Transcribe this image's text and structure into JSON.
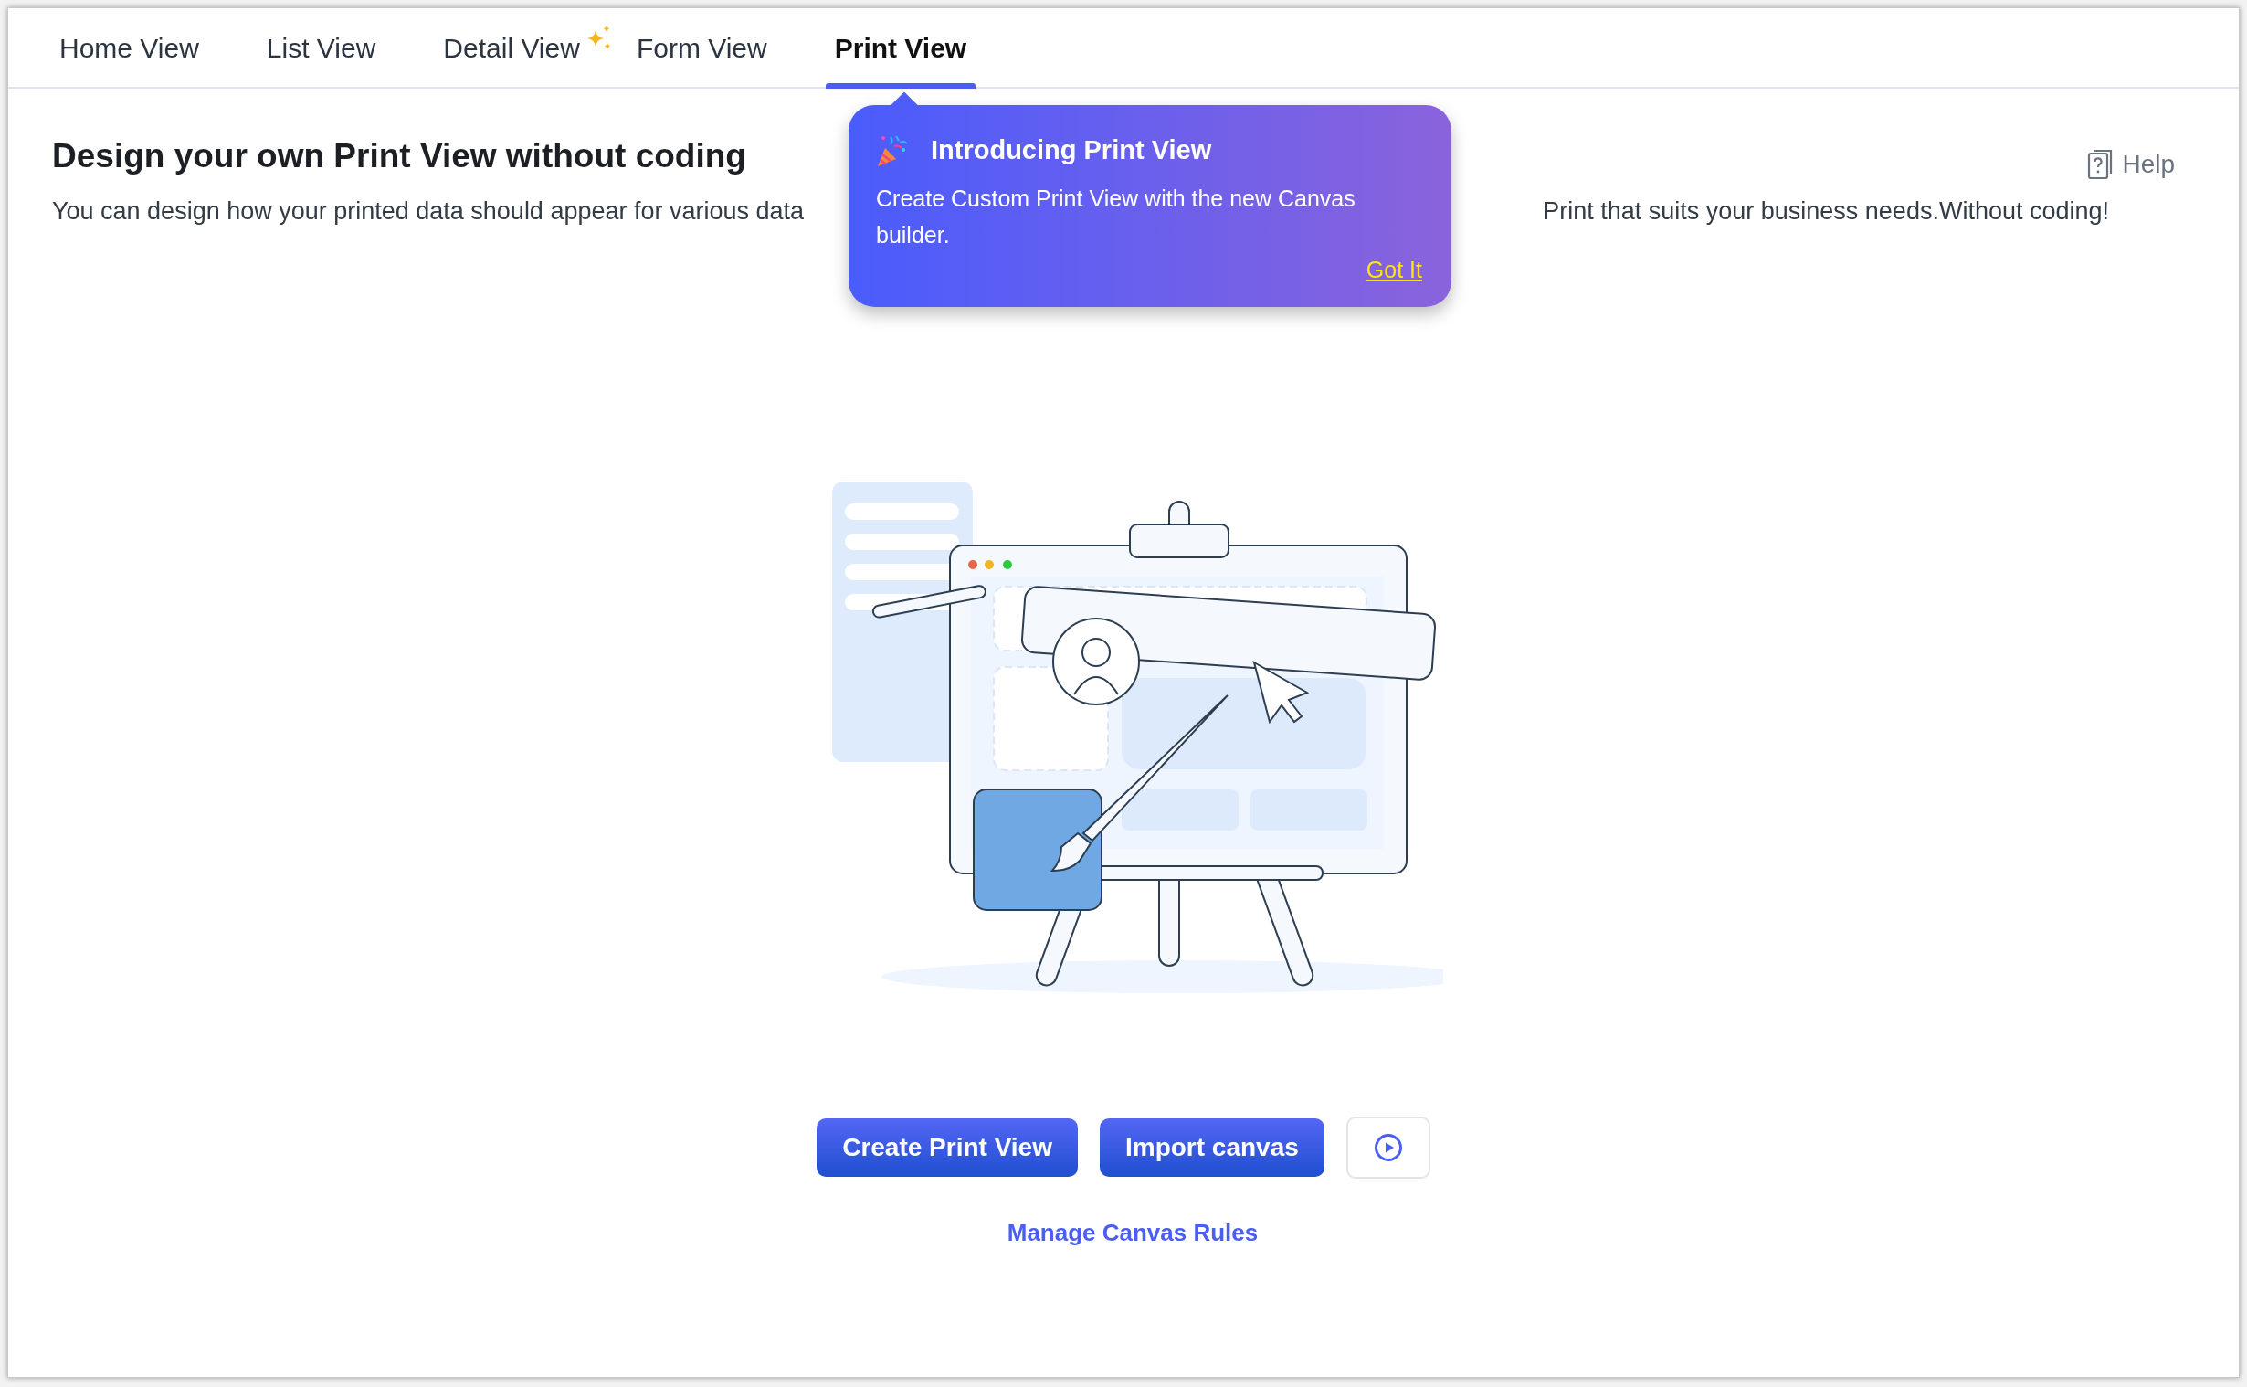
{
  "tabs": [
    {
      "label": "Home View",
      "selected": false,
      "new": false
    },
    {
      "label": "List View",
      "selected": false,
      "new": false
    },
    {
      "label": "Detail View",
      "selected": false,
      "new": true
    },
    {
      "label": "Form View",
      "selected": false,
      "new": false
    },
    {
      "label": "Print View",
      "selected": true,
      "new": false
    }
  ],
  "header": {
    "title": "Design your own Print View without coding",
    "description_left": "You can design how your printed data should appear for various data",
    "description_right": "Print that suits your business needs.Without coding!",
    "help": "Help"
  },
  "tooltip": {
    "title": "Introducing Print View",
    "body": "Create Custom Print View with the new Canvas builder.",
    "action": "Got It"
  },
  "actions": {
    "primary": [
      "Create Print View",
      "Import canvas"
    ],
    "link": "Manage Canvas Rules"
  }
}
